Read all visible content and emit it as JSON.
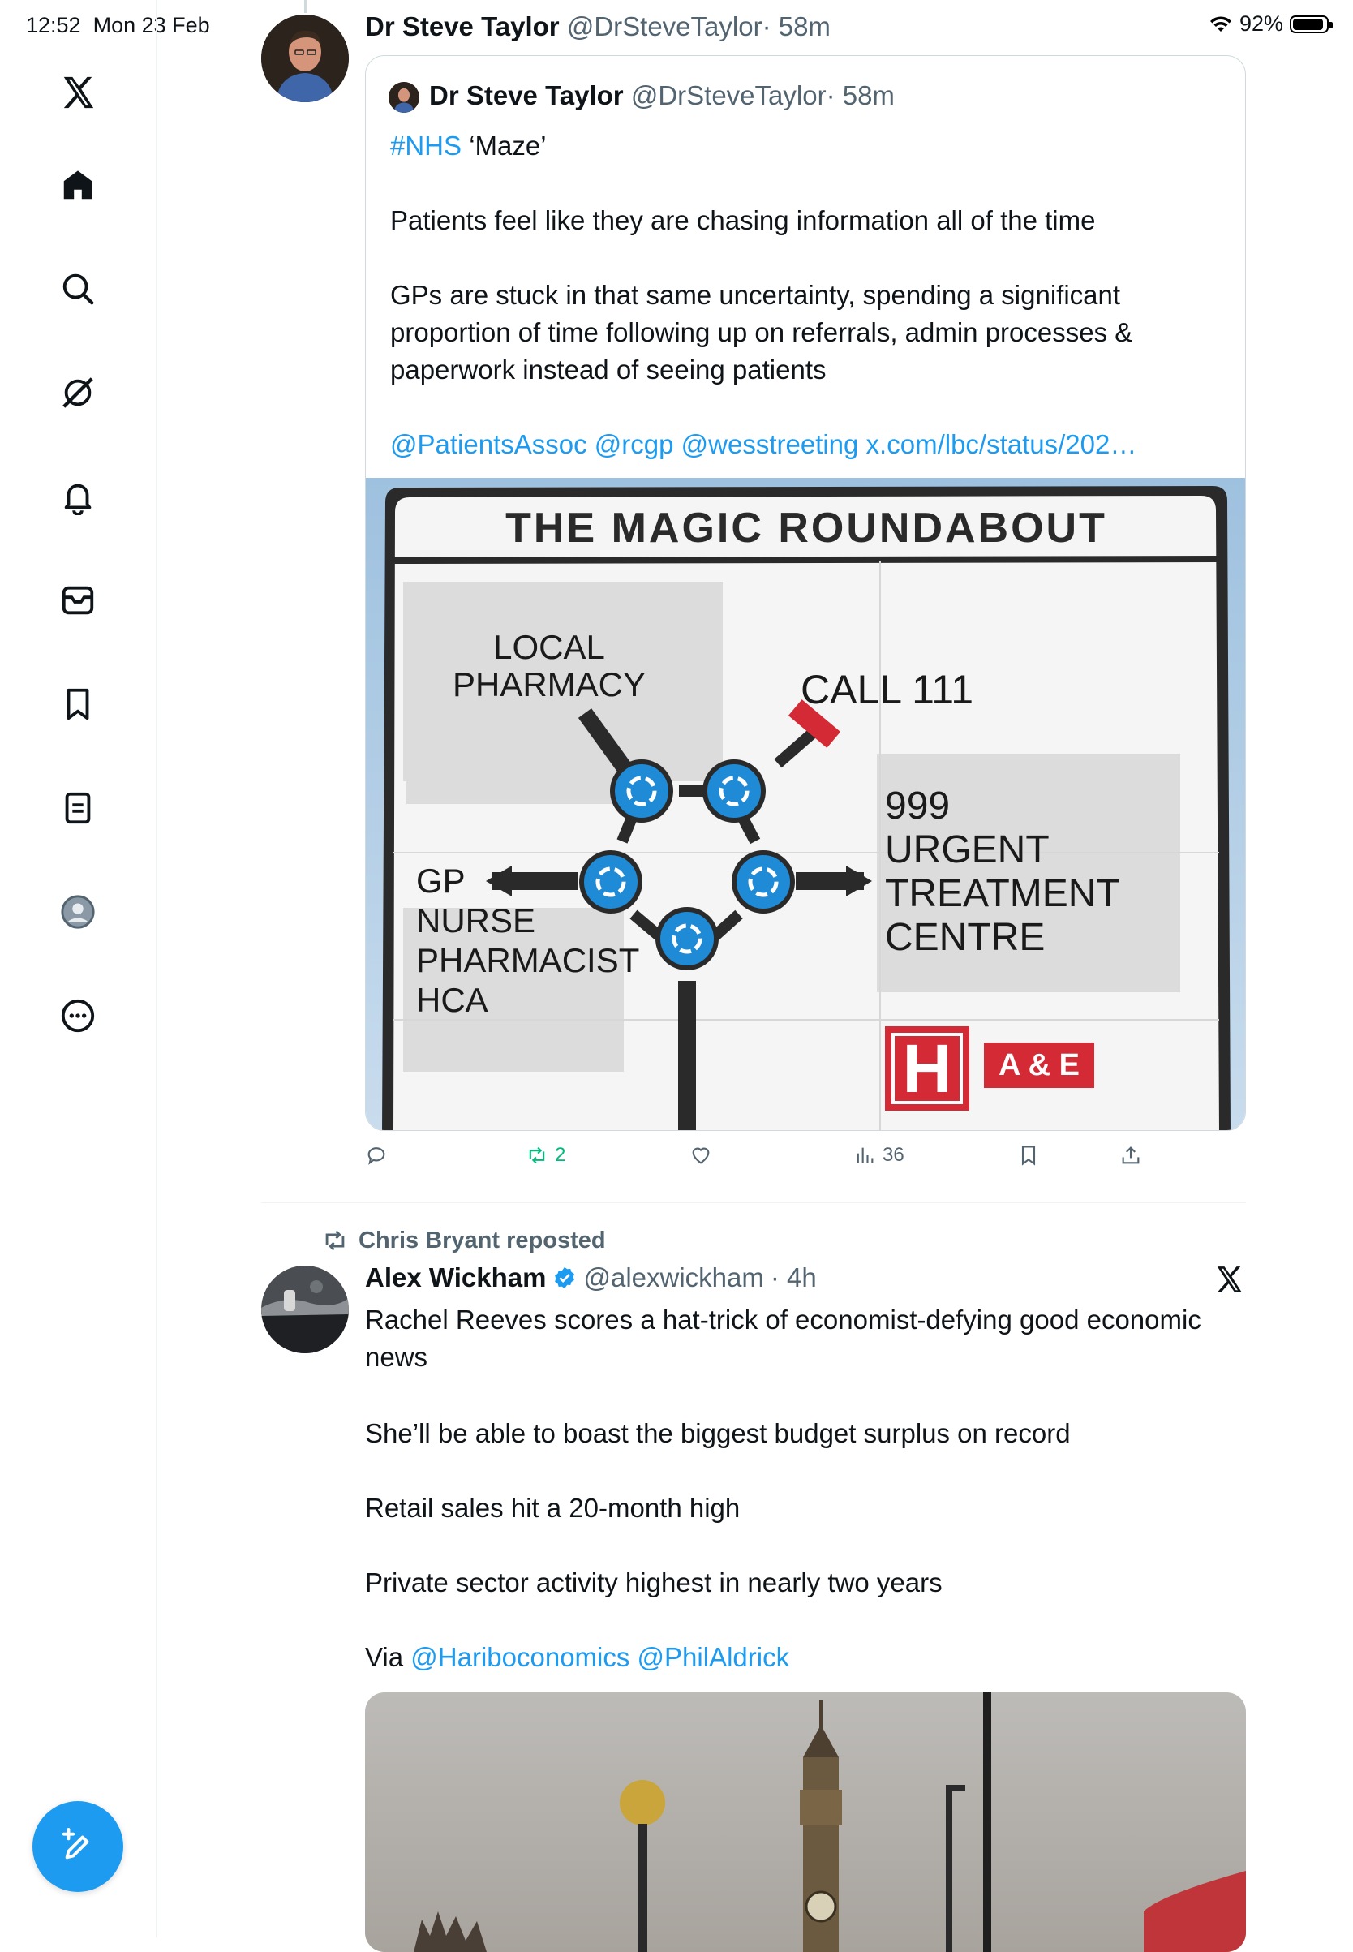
{
  "status_bar": {
    "time": "12:52",
    "date": "Mon 23 Feb",
    "battery": "92%",
    "battery_level": 0.92
  },
  "sidebar": {
    "items": [
      {
        "icon": "x-logo-icon"
      },
      {
        "icon": "home-icon"
      },
      {
        "icon": "search-icon"
      },
      {
        "icon": "grok-icon"
      },
      {
        "icon": "bell-icon"
      },
      {
        "icon": "mail-icon"
      },
      {
        "icon": "bookmark-icon"
      },
      {
        "icon": "lists-icon"
      },
      {
        "icon": "profile-icon"
      },
      {
        "icon": "more-icon"
      }
    ],
    "compose_icon": "compose-icon"
  },
  "colors": {
    "accent": "#1d9bf0",
    "text": "#0f1419",
    "muted": "#536471",
    "repost_green": "#00ba7c"
  },
  "tweet1": {
    "name": "Dr Steve Taylor",
    "handle": "@DrSteveTaylor",
    "time": "· 58m",
    "quote": {
      "name": "Dr Steve Taylor",
      "handle": "@DrSteveTaylor",
      "time": "· 58m",
      "hashtag": "#NHS",
      "title_rest": " ‘Maze’",
      "para1": "Patients feel like they are chasing information all of the time",
      "para2": "GPs are stuck in that same uncertainty, spending a significant\nproportion of time following up on referrals, admin processes &\npaperwork instead of seeing patients",
      "mentions": "@PatientsAssoc @rcgp @wesstreeting x.com/lbc/status/202…",
      "image": {
        "title": "THE MAGIC ROUNDABOUT",
        "label_pharmacy_1": "LOCAL",
        "label_pharmacy_2": "PHARMACY",
        "label_call": "CALL 111",
        "label_gp_1": "GP",
        "label_gp_2": "NURSE",
        "label_gp_3": "PHARMACIST",
        "label_gp_4": "HCA",
        "label_999_1": "999",
        "label_999_2": "URGENT",
        "label_999_3": "TREATMENT",
        "label_999_4": "CENTRE",
        "label_h": "H",
        "label_ae": "A & E"
      }
    },
    "actions": {
      "reply": "",
      "reposts": "2",
      "likes": "",
      "views": "36"
    }
  },
  "tweet2": {
    "reposted_by": "Chris Bryant reposted",
    "name": "Alex Wickham",
    "handle": "@alexwickham",
    "time": "· 4h",
    "para1": "Rachel Reeves scores a hat-trick of economist-defying good economic\nnews",
    "para2": "She’ll be able to boast the biggest budget surplus on record",
    "para3": "Retail sales hit a 20-month high",
    "para4": "Private sector activity highest in nearly two years",
    "via_prefix": "Via ",
    "via_mentions": "@Hariboconomics @PhilAldrick"
  }
}
